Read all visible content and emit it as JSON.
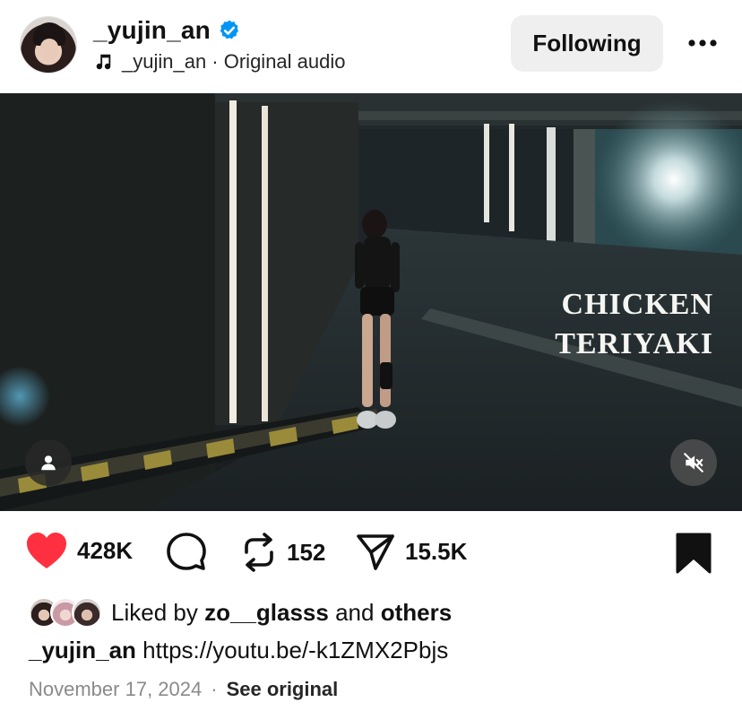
{
  "post": {
    "username": "_yujin_an",
    "verified": true,
    "audio_label": "_yujin_an · Original audio",
    "follow_label": "Following",
    "more_icon": "more-horizontal-icon"
  },
  "video": {
    "overlay_title_line1": "CHICKEN",
    "overlay_title_line2": "TERIYAKI",
    "muted": true
  },
  "actions": {
    "like_count": "428K",
    "liked": true,
    "repost_count": "152",
    "share_count": "15.5K",
    "saved": true
  },
  "likes": {
    "prefix": "Liked by",
    "first_user": "zo__glasss",
    "conj": "and",
    "others": "others"
  },
  "caption": {
    "username": "_yujin_an",
    "text": "https://youtu.be/-k1ZMX2Pbjs"
  },
  "meta": {
    "date": "November 17, 2024",
    "separator": "·",
    "see_original": "See original"
  },
  "colors": {
    "like_red": "#ff3040",
    "verified_blue": "#0095f6",
    "follow_bg": "#efefef"
  }
}
